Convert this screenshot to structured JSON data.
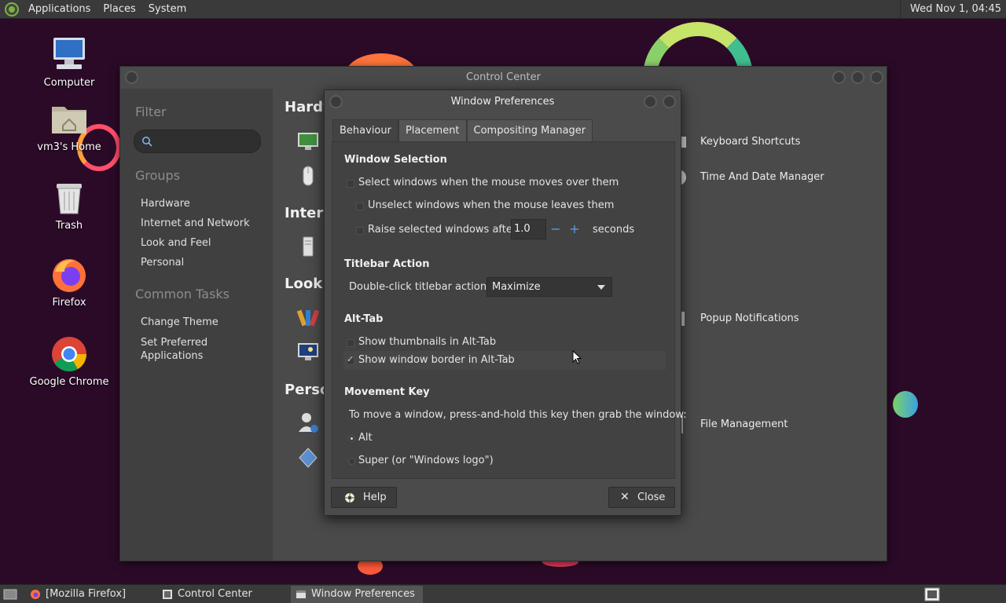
{
  "top_panel": {
    "menus": [
      "Applications",
      "Places",
      "System"
    ],
    "clock": "Wed Nov 1, 04:45"
  },
  "desktop_icons": [
    {
      "label": "Computer"
    },
    {
      "label": "vm3's Home"
    },
    {
      "label": "Trash"
    },
    {
      "label": "Firefox"
    },
    {
      "label": "Google Chrome"
    }
  ],
  "control_center": {
    "title": "Control Center",
    "sidebar": {
      "filter_heading": "Filter",
      "groups_heading": "Groups",
      "groups": [
        "Hardware",
        "Internet and Network",
        "Look and Feel",
        "Personal"
      ],
      "tasks_heading": "Common Tasks",
      "tasks": [
        "Change Theme",
        "Set Preferred\nApplications"
      ]
    },
    "sections": [
      "Hardv",
      "Intern",
      "Look a",
      "Perso"
    ],
    "right_items": [
      "Keyboard Shortcuts",
      "Time And Date Manager",
      "Popup Notifications",
      "File Management"
    ]
  },
  "window_prefs": {
    "title": "Window Preferences",
    "tabs": [
      "Behaviour",
      "Placement",
      "Compositing Manager"
    ],
    "window_selection": {
      "heading": "Window Selection",
      "select_on_hover": "Select windows when the mouse moves over them",
      "unselect_on_leave": "Unselect windows when the mouse leaves them",
      "raise_after": "Raise selected windows after",
      "raise_value": "1.0",
      "seconds": "seconds"
    },
    "titlebar": {
      "heading": "Titlebar Action",
      "label": "Double-click titlebar action:",
      "value": "Maximize"
    },
    "alt_tab": {
      "heading": "Alt-Tab",
      "thumbnails": "Show thumbnails in Alt-Tab",
      "border": "Show window border in Alt-Tab",
      "border_checked": true
    },
    "movement": {
      "heading": "Movement Key",
      "desc": "To move a window, press-and-hold this key then grab the window:",
      "options": [
        "Alt",
        "Super (or \"Windows logo\")"
      ],
      "selected": "Alt"
    },
    "help_label": "Help",
    "close_label": "Close"
  },
  "taskbar": {
    "tasks": [
      "[Mozilla Firefox]",
      "Control Center",
      "Window Preferences"
    ],
    "active": "Window Preferences"
  },
  "colors": {
    "panel": "#3a3a3a",
    "wallpaper": "#2b0a28",
    "spin_accent": "#5aa0e0"
  }
}
